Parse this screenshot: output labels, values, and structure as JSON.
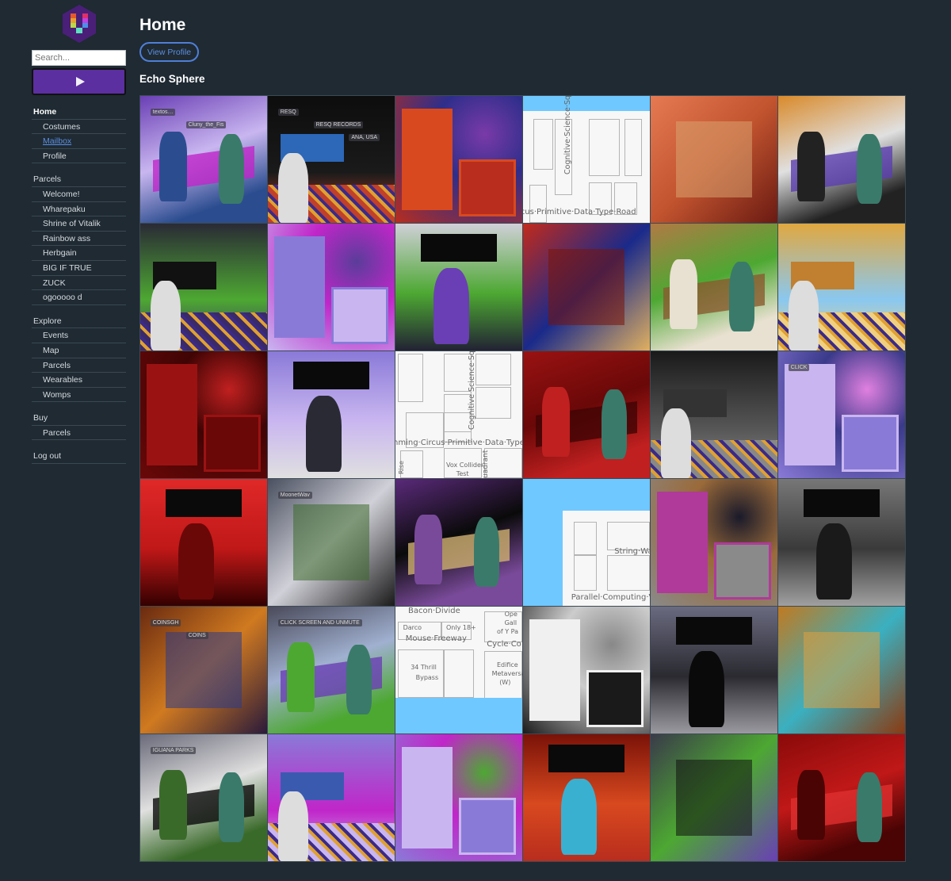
{
  "sidebar": {
    "logo_icon": "voxel-hexagon-logo",
    "search_placeholder": "Search...",
    "search_value": "",
    "play_icon": "play-icon",
    "groups": [
      {
        "items": [
          {
            "label": "Home",
            "type": "head-bold"
          },
          {
            "label": "Costumes",
            "type": "sub"
          },
          {
            "label": "Mailbox",
            "type": "sub-link"
          },
          {
            "label": "Profile",
            "type": "sub"
          }
        ]
      },
      {
        "items": [
          {
            "label": "Parcels",
            "type": "head"
          },
          {
            "label": "Welcome!",
            "type": "sub"
          },
          {
            "label": "Wharepaku",
            "type": "sub"
          },
          {
            "label": "Shrine of Vitalik",
            "type": "sub"
          },
          {
            "label": "Rainbow ass",
            "type": "sub"
          },
          {
            "label": "Herbgain",
            "type": "sub"
          },
          {
            "label": "BIG IF TRUE",
            "type": "sub"
          },
          {
            "label": "ZUCK",
            "type": "sub"
          },
          {
            "label": "ogooooo d",
            "type": "sub"
          }
        ]
      },
      {
        "items": [
          {
            "label": "Explore",
            "type": "head"
          },
          {
            "label": "Events",
            "type": "sub"
          },
          {
            "label": "Map",
            "type": "sub"
          },
          {
            "label": "Parcels",
            "type": "sub"
          },
          {
            "label": "Wearables",
            "type": "sub"
          },
          {
            "label": "Womps",
            "type": "sub"
          }
        ]
      },
      {
        "items": [
          {
            "label": "Buy",
            "type": "head"
          },
          {
            "label": "Parcels",
            "type": "sub"
          }
        ]
      },
      {
        "items": [
          {
            "label": "Log out",
            "type": "head"
          }
        ]
      }
    ]
  },
  "main": {
    "title": "Home",
    "view_profile_label": "View Profile",
    "section_title": "Echo Sphere",
    "tiles": [
      {
        "kind": "scene",
        "desc": "avatars on purple sofa",
        "colors": [
          "#6a3fb5",
          "#c9b6f0",
          "#2b4d8f",
          "#c026c9"
        ],
        "labels": [
          "textos…",
          "Cluny_the_Fis"
        ]
      },
      {
        "kind": "scene",
        "desc": "RESQ records store",
        "colors": [
          "#0d0d0d",
          "#1a1a1a",
          "#c0402a",
          "#2c67b8"
        ],
        "labels": [
          "RESQ",
          "RESQ RECORDS",
          "ANA, USA"
        ]
      },
      {
        "kind": "scene",
        "desc": "orange and red blocks",
        "colors": [
          "#d8491f",
          "#b82d1e",
          "#7a3aa8",
          "#2e2e8a"
        ],
        "labels": []
      },
      {
        "kind": "map",
        "variant": "a",
        "labels": [
          "Cognitive·Science·Square",
          "cus·Primitive·Data·Type·Road"
        ]
      },
      {
        "kind": "scene",
        "desc": "red artwork painting",
        "colors": [
          "#e57a52",
          "#c2542f",
          "#6a1a12",
          "#d9a270"
        ],
        "labels": []
      },
      {
        "kind": "scene",
        "desc": "checkered gallery corridor",
        "colors": [
          "#d98a2a",
          "#e0e0e0",
          "#222",
          "#5b3fb0"
        ],
        "labels": []
      },
      {
        "kind": "scene",
        "desc": "dj stage with plants",
        "colors": [
          "#2a2a35",
          "#4da832",
          "#3b2a6a",
          "#111"
        ],
        "labels": []
      },
      {
        "kind": "scene",
        "desc": "purple palm lounge",
        "colors": [
          "#8a7ad8",
          "#c9b6f0",
          "#5a3d9a",
          "#c026c9"
        ],
        "labels": []
      },
      {
        "kind": "scene",
        "desc": "tiger avatar with plants",
        "colors": [
          "#4da832",
          "#d0d0d8",
          "#6a3fb5",
          "#223"
        ],
        "labels": []
      },
      {
        "kind": "scene",
        "desc": "red tunnel",
        "colors": [
          "#c22a1a",
          "#1a2a8a",
          "#e0b060",
          "#7a1208"
        ],
        "labels": []
      },
      {
        "kind": "scene",
        "desc": "pizza wall",
        "colors": [
          "#b07a45",
          "#4da832",
          "#e8e0d0",
          "#8a5a30"
        ],
        "labels": []
      },
      {
        "kind": "scene",
        "desc": "sunny room with windows",
        "colors": [
          "#e0a840",
          "#8ac8f0",
          "#f0d080",
          "#c08030"
        ],
        "labels": []
      },
      {
        "kind": "scene",
        "desc": "dark red room",
        "colors": [
          "#9a1212",
          "#6a0808",
          "#c02020",
          "#400404"
        ],
        "labels": []
      },
      {
        "kind": "scene",
        "desc": "purple store with avatar",
        "colors": [
          "#c9b6f0",
          "#8a7ad8",
          "#2a2a35",
          "#e0e0e0"
        ],
        "labels": []
      },
      {
        "kind": "map",
        "variant": "b",
        "labels": [
          "Cognitive·Science·Squar",
          "mming·Circus·Primitive·Data·Type·R",
          "Vox Collider",
          "Test",
          "Rise",
          "uadrant"
        ]
      },
      {
        "kind": "scene",
        "desc": "avatar in red room",
        "colors": [
          "#9a1212",
          "#6a0808",
          "#c02020",
          "#400404"
        ],
        "labels": []
      },
      {
        "kind": "scene",
        "desc": "grayscale street",
        "colors": [
          "#1a1a1a",
          "#555",
          "#888",
          "#333"
        ],
        "labels": []
      },
      {
        "kind": "scene",
        "desc": "neon store front",
        "colors": [
          "#c9b6f0",
          "#8a7ad8",
          "#e080e0",
          "#3a3a8a"
        ],
        "labels": [
          "CLICK"
        ]
      },
      {
        "kind": "scene",
        "desc": "red cube room",
        "colors": [
          "#c01818",
          "#e02828",
          "#6a0808",
          "#300"
        ],
        "labels": []
      },
      {
        "kind": "scene",
        "desc": "avatars on balcony",
        "colors": [
          "#4a5060",
          "#d0d0d8",
          "#1a1a1a",
          "#3a6a2a"
        ],
        "labels": [
          "MoonetWav"
        ]
      },
      {
        "kind": "scene",
        "desc": "gallery wall with paintings",
        "colors": [
          "#5a2a7a",
          "#0a0a0a",
          "#7a4a9a",
          "#d0b070"
        ],
        "labels": []
      },
      {
        "kind": "map",
        "variant": "c",
        "labels": [
          "String·Wa",
          "Parallel·Computing·V"
        ]
      },
      {
        "kind": "scene",
        "desc": "pink room moon painting",
        "colors": [
          "#b03a9a",
          "#8a8a8a",
          "#1a1a2a",
          "#9a6a3a"
        ],
        "labels": []
      },
      {
        "kind": "scene",
        "desc": "dim industrial hall",
        "colors": [
          "#3a3a3a",
          "#777",
          "#1a1a1a",
          "#a0a0a0"
        ],
        "labels": []
      },
      {
        "kind": "scene",
        "desc": "coinsight cave",
        "colors": [
          "#6a2a10",
          "#d07a20",
          "#2a1a3a",
          "#2a3a8a"
        ],
        "labels": [
          "COINSGH",
          "COINS"
        ]
      },
      {
        "kind": "scene",
        "desc": "dj stage pool",
        "colors": [
          "#4a4a5a",
          "#a0b0d0",
          "#4da832",
          "#6a3fb5"
        ],
        "labels": [
          "CLICK SCREEN AND UNMUTE"
        ]
      },
      {
        "kind": "map",
        "variant": "d",
        "labels": [
          "Bacon·Divide",
          "Darco",
          "Only 18+",
          "Mouse·Freeway",
          "34 Thrill",
          "Bypass",
          "Cycle·Co",
          "Ope",
          "Gall",
          "of Y Pa",
          "Edifice",
          "Metaversa",
          "(W)"
        ]
      },
      {
        "kind": "scene",
        "desc": "white modern building",
        "colors": [
          "#f0f0f0",
          "#1a1a1a",
          "#888",
          "#ccc"
        ],
        "labels": []
      },
      {
        "kind": "scene",
        "desc": "big screen plaza",
        "colors": [
          "#2a2a30",
          "#6a6a80",
          "#0a0a0a",
          "#9a9aa0"
        ],
        "labels": []
      },
      {
        "kind": "scene",
        "desc": "warm wooden room",
        "colors": [
          "#c07a20",
          "#3ab0c0",
          "#8a3a10",
          "#e0a040"
        ],
        "labels": []
      },
      {
        "kind": "scene",
        "desc": "iguana parks stage",
        "colors": [
          "#6a6a7a",
          "#e0e0e0",
          "#3a6a2a",
          "#0a0a0a"
        ],
        "labels": [
          "IGUANA PARKS"
        ]
      },
      {
        "kind": "scene",
        "desc": "neon venue avatar",
        "colors": [
          "#8a7ad8",
          "#c026c9",
          "#c9b6f0",
          "#3a5ab0"
        ],
        "labels": []
      },
      {
        "kind": "scene",
        "desc": "crowd in neon hall",
        "colors": [
          "#c9b6f0",
          "#8a7ad8",
          "#4da832",
          "#c026c9"
        ],
        "labels": []
      },
      {
        "kind": "scene",
        "desc": "red patterned floor",
        "colors": [
          "#d8491f",
          "#7a1208",
          "#3ab0d0",
          "#b82d1e"
        ],
        "labels": []
      },
      {
        "kind": "scene",
        "desc": "dj avatar with speakers",
        "colors": [
          "#3a3a4a",
          "#4da832",
          "#6a3fb5",
          "#111"
        ],
        "labels": []
      },
      {
        "kind": "scene",
        "desc": "red dancer room",
        "colors": [
          "#8a0a0a",
          "#c01818",
          "#4a0404",
          "#e03030"
        ],
        "labels": []
      }
    ]
  }
}
